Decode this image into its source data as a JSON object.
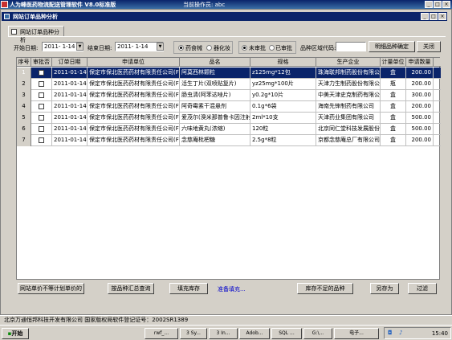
{
  "app": {
    "title": "人为峰医药物流配送管理软件 V8.0标准版",
    "operator": "当前操作员: abc"
  },
  "window": {
    "title": "网站订单品种分析",
    "tab": "网站订单品种分析"
  },
  "filters": {
    "start_label": "开始日期:",
    "start_value": "2011- 1-14",
    "end_label": "结束日期:",
    "end_value": "2011- 1-14",
    "radio_group1": [
      {
        "label": "药食械",
        "selected": true
      },
      {
        "label": "器化妆",
        "selected": false
      }
    ],
    "radio_group2": [
      {
        "label": "未审批",
        "selected": true
      },
      {
        "label": "已审批",
        "selected": false
      }
    ],
    "region_label": "品种区域代码:",
    "region_value": "",
    "confirm_button": "明细品种确定",
    "close_button": "关闭"
  },
  "table": {
    "columns": [
      "序号",
      "审批否",
      "订单日期",
      "申请单位",
      "品名",
      "规格",
      "生产企业",
      "计量单位",
      "申请数量"
    ],
    "rows": [
      {
        "no": "1",
        "checked": false,
        "date": "2011-01-14",
        "unit": "保定市保北医药药材有限责任公司(F)",
        "name": "阿莫西林颗粒",
        "spec": "z125mg*12包",
        "maker": "珠海联邦制药股份有限公司中山分公司",
        "uom": "盒",
        "qty": "200.00",
        "selected": true
      },
      {
        "no": "2",
        "checked": false,
        "date": "2011-01-14",
        "unit": "保定市保北医药药材有限责任公司(F)",
        "name": "活生丁片(双喷贴复片)",
        "spec": "yz25mg*100片",
        "maker": "天津力生制药股份有限公司",
        "uom": "瓶",
        "qty": "200.00",
        "selected": false
      },
      {
        "no": "3",
        "checked": false,
        "date": "2011-01-14",
        "unit": "保定市保北医药药材有限责任公司(F)",
        "name": "肠虫清(阿苯达唑片)",
        "spec": "y0.2g*10片",
        "maker": "中美天津史克制药有限公司",
        "uom": "盒",
        "qty": "300.00",
        "selected": false
      },
      {
        "no": "4",
        "checked": false,
        "date": "2011-01-14",
        "unit": "保定市保北医药药材有限责任公司(F)",
        "name": "阿奇霉素干混悬剂",
        "spec": "0.1g*6袋",
        "maker": "海南先锋制药有限公司",
        "uom": "盒",
        "qty": "200.00",
        "selected": false
      },
      {
        "no": "5",
        "checked": false,
        "date": "2011-01-14",
        "unit": "保定市保北医药药材有限责任公司(F)",
        "name": "爱茂尔(溴米那普鲁卡因注射",
        "spec": "2ml*10支",
        "maker": "天津药业集团有限公司",
        "uom": "盒",
        "qty": "500.00",
        "selected": false
      },
      {
        "no": "6",
        "checked": false,
        "date": "2011-01-14",
        "unit": "保定市保北医药药材有限责任公司(F)",
        "name": "六味地黄丸(浓缩)",
        "spec": "120粒",
        "maker": "北京同仁堂科技发展股份有限公司",
        "uom": "盒",
        "qty": "500.00",
        "selected": false
      },
      {
        "no": "7",
        "checked": false,
        "date": "2011-01-14",
        "unit": "保定市保北医药药材有限责任公司(F)",
        "name": "念慈庵枇杷糖",
        "spec": "2.5g*8粒",
        "maker": "京都念慈庵总厂有限公司",
        "uom": "盒",
        "qty": "200.00",
        "selected": false
      }
    ]
  },
  "bottom": {
    "btn_unit_mismatch": "网站单价不等计划单价的",
    "btn_summary": "按品种汇总查询",
    "btn_fill_stock": "填充库存",
    "status_text": "准备填充...",
    "btn_shortage": "库存不足的品种",
    "btn_save_as": "另存为",
    "btn_filter": "过滤"
  },
  "footer": {
    "registration": "北京万通恒邦科技开发有限公司  国家版权局软件登记证号：2002SR1389"
  },
  "taskbar": {
    "start": "开始",
    "tasks": [
      "rwf_...",
      "3 Sy...",
      "3 In...",
      "Adob...",
      "SQL ...",
      "G:\\...",
      "电子..."
    ],
    "clock": "15:40"
  }
}
